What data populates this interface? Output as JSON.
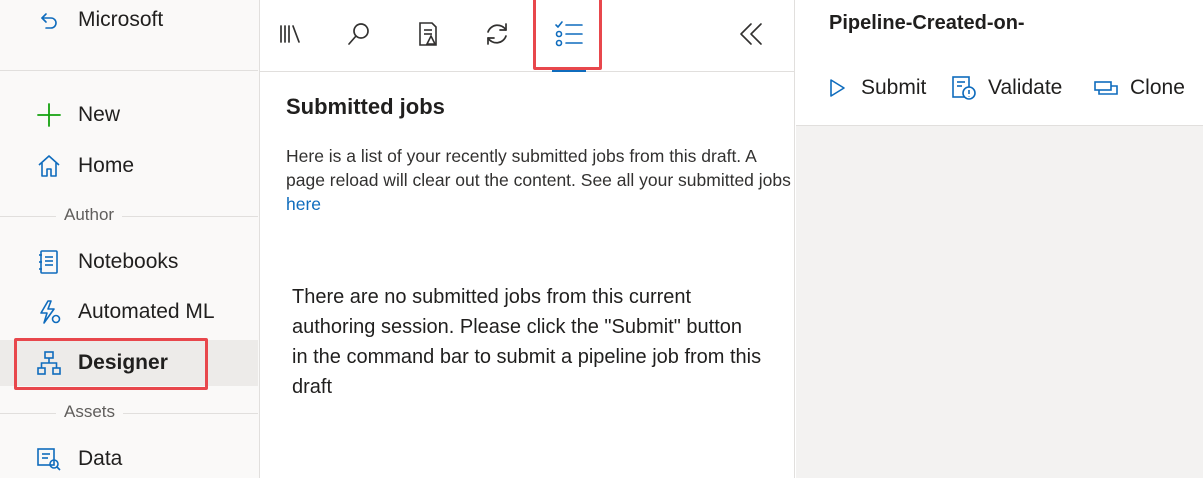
{
  "nav": {
    "workspace": {
      "label": "Microsoft",
      "icon": "back-arrow-icon"
    },
    "items_top": [
      {
        "label": "New",
        "icon": "plus-icon"
      },
      {
        "label": "Home",
        "icon": "home-icon"
      }
    ],
    "section_author": "Author",
    "items_author": [
      {
        "label": "Notebooks",
        "icon": "notebook-icon"
      },
      {
        "label": "Automated ML",
        "icon": "lightning-icon"
      },
      {
        "label": "Designer",
        "icon": "hierarchy-icon",
        "selected": true
      }
    ],
    "section_assets": "Assets",
    "items_assets": [
      {
        "label": "Data",
        "icon": "data-icon"
      }
    ]
  },
  "panel": {
    "tabs": [
      {
        "name": "library",
        "icon": "library-icon"
      },
      {
        "name": "search",
        "icon": "search-icon"
      },
      {
        "name": "report",
        "icon": "report-icon"
      },
      {
        "name": "refresh",
        "icon": "refresh-icon"
      },
      {
        "name": "submitted-jobs",
        "icon": "task-list-icon",
        "active": true
      }
    ],
    "collapse_icon": "double-chevron-left-icon",
    "title": "Submitted jobs",
    "description": "Here is a list of your recently submitted jobs from this draft. A page reload will clear out the content. See all your submitted jobs",
    "description_link": "here",
    "empty_message": "There are no submitted jobs from this current authoring session. Please click the \"Submit\" button in the command bar to submit a pipeline job from this draft"
  },
  "right": {
    "pipeline_title": "Pipeline-Created-on-",
    "commands": [
      {
        "label": "Submit",
        "icon": "play-icon"
      },
      {
        "label": "Validate",
        "icon": "validate-icon"
      },
      {
        "label": "Clone",
        "icon": "clone-icon"
      }
    ]
  },
  "colors": {
    "accent": "#0f6cbd",
    "highlight": "#e8474c",
    "new_icon": "#13a10e",
    "nav_bg": "#faf9f8",
    "selected_bg": "#edebe9"
  }
}
